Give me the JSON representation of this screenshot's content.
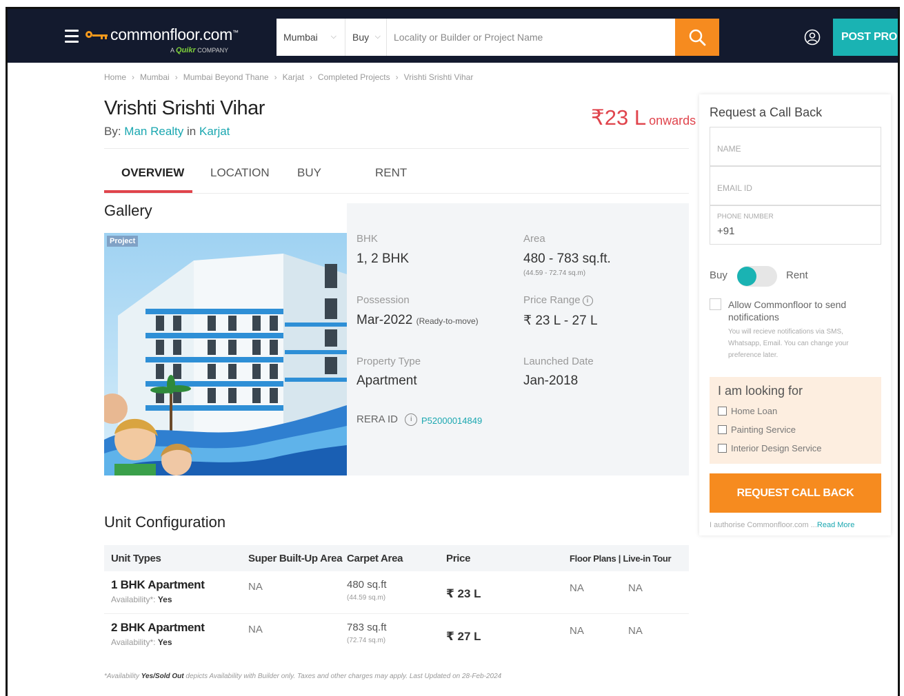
{
  "header": {
    "logo_text": "commonfloor.com",
    "logo_tm": "™",
    "logo_sub_prefix": "A ",
    "logo_sub_brand": "Quikr",
    "logo_sub_suffix": " COMPANY",
    "city": "Mumbai",
    "type": "Buy",
    "search_placeholder": "Locality or Builder or Project Name",
    "post_button": "POST PROPERTY"
  },
  "breadcrumb": [
    "Home",
    "Mumbai",
    "Mumbai Beyond Thane",
    "Karjat",
    "Completed Projects",
    "Vrishti Srishti Vihar"
  ],
  "project": {
    "title": "Vrishti Srishti Vihar",
    "by_label": "By",
    "builder": "Man Realty",
    "in_label": "in",
    "location": "Karjat",
    "price_big": "₹23 L",
    "price_suffix": "onwards"
  },
  "tabs": [
    "OVERVIEW",
    "LOCATION",
    "BUY",
    "RENT"
  ],
  "gallery": {
    "title": "Gallery",
    "tag": "Project"
  },
  "info": {
    "bhk_label": "BHK",
    "bhk_value": "1, 2 BHK",
    "area_label": "Area",
    "area_value": "480 - 783 sq.ft.",
    "area_sub": "(44.59 - 72.74 sq.m)",
    "possession_label": "Possession",
    "possession_value": "Mar-2022",
    "possession_note": "(Ready-to-move)",
    "price_range_label": "Price Range",
    "price_range_value": "₹ 23 L - 27 L",
    "property_type_label": "Property Type",
    "property_type_value": "Apartment",
    "launched_label": "Launched Date",
    "launched_value": "Jan-2018",
    "rera_label": "RERA ID",
    "rera_value": "P52000014849"
  },
  "units": {
    "title": "Unit Configuration",
    "headers": [
      "Unit Types",
      "Super Built-Up Area",
      "Carpet Area",
      "Price",
      "Floor Plans | Live-in Tour"
    ],
    "rows": [
      {
        "name": "1 BHK Apartment",
        "avail_label": "Availability*:",
        "avail": "Yes",
        "super": "NA",
        "carpet": "480 sq.ft",
        "carpet_sub": "(44.59 sq.m)",
        "price": "₹ 23 L",
        "floor": "NA",
        "tour": "NA"
      },
      {
        "name": "2 BHK Apartment",
        "avail_label": "Availability*:",
        "avail": "Yes",
        "super": "NA",
        "carpet": "783 sq.ft",
        "carpet_sub": "(72.74 sq.m)",
        "price": "₹ 27 L",
        "floor": "NA",
        "tour": "NA"
      }
    ],
    "footnote_prefix": "*Availability ",
    "footnote_bold": "Yes/Sold Out",
    "footnote_suffix": " depicts Availability with Builder only. Taxes and other charges may apply. Last Updated on 28-Feb-2024"
  },
  "callback": {
    "title": "Request a Call Back",
    "name_placeholder": "NAME",
    "email_placeholder": "EMAIL ID",
    "phone_label": "PHONE NUMBER",
    "phone_prefix": "+91",
    "buy_label": "Buy",
    "rent_label": "Rent",
    "notif_text": "Allow Commonfloor to send notifications",
    "notif_sub": "You will recieve notifications via SMS, Whatsapp, Email. You can change your preference later.",
    "looking_title": "I am looking for",
    "looking_options": [
      "Home Loan",
      "Painting Service",
      "Interior Design Service"
    ],
    "button": "REQUEST CALL BACK",
    "authorise_text": "I authorise Commonfloor.com ...",
    "read_more": "Read More"
  }
}
